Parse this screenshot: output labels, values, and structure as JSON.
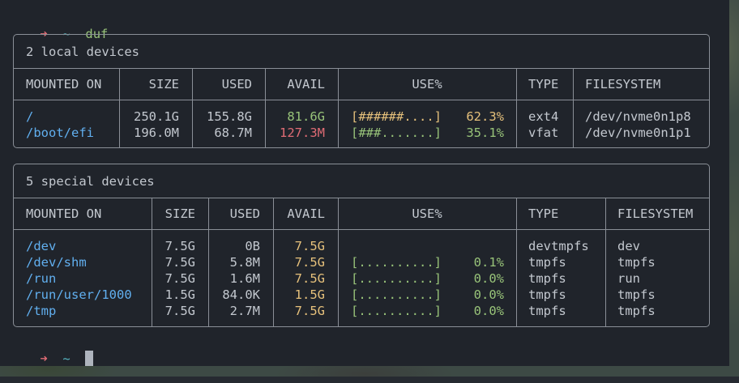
{
  "prompt": {
    "arrow": "➜",
    "dir": "~",
    "command": "duf"
  },
  "local": {
    "title": "2 local devices",
    "headers": [
      "MOUNTED ON",
      "SIZE",
      "USED",
      "AVAIL",
      "USE%",
      "TYPE",
      "FILESYSTEM"
    ],
    "rows": [
      {
        "mount": "/",
        "size": "250.1G",
        "used": "155.8G",
        "avail": "81.6G",
        "bar": "[######....]",
        "pct": "62.3%",
        "type": "ext4",
        "fs": "/dev/nvme0n1p8",
        "avail_color": "green",
        "bar_color": "yellow"
      },
      {
        "mount": "/boot/efi",
        "size": "196.0M",
        "used": "68.7M",
        "avail": "127.3M",
        "bar": "[###.......]",
        "pct": "35.1%",
        "type": "vfat",
        "fs": "/dev/nvme0n1p1",
        "avail_color": "red",
        "bar_color": "green"
      }
    ]
  },
  "special": {
    "title": "5 special devices",
    "headers": [
      "MOUNTED ON",
      "SIZE",
      "USED",
      "AVAIL",
      "USE%",
      "TYPE",
      "FILESYSTEM"
    ],
    "rows": [
      {
        "mount": "/dev",
        "size": "7.5G",
        "used": "0B",
        "avail": "7.5G",
        "bar": "",
        "pct": "",
        "type": "devtmpfs",
        "fs": "dev"
      },
      {
        "mount": "/dev/shm",
        "size": "7.5G",
        "used": "5.8M",
        "avail": "7.5G",
        "bar": "[..........]",
        "pct": "0.1%",
        "type": "tmpfs",
        "fs": "tmpfs"
      },
      {
        "mount": "/run",
        "size": "7.5G",
        "used": "1.6M",
        "avail": "7.5G",
        "bar": "[..........]",
        "pct": "0.0%",
        "type": "tmpfs",
        "fs": "run"
      },
      {
        "mount": "/run/user/1000",
        "size": "1.5G",
        "used": "84.0K",
        "avail": "1.5G",
        "bar": "[..........]",
        "pct": "0.0%",
        "type": "tmpfs",
        "fs": "tmpfs"
      },
      {
        "mount": "/tmp",
        "size": "7.5G",
        "used": "2.7M",
        "avail": "7.5G",
        "bar": "[..........]",
        "pct": "0.0%",
        "type": "tmpfs",
        "fs": "tmpfs"
      }
    ]
  },
  "colors": {
    "accent_red": "#e06c75",
    "accent_green": "#98c379",
    "accent_yellow": "#e5c07b",
    "accent_blue": "#61afef",
    "accent_cyan": "#56b6c2"
  }
}
